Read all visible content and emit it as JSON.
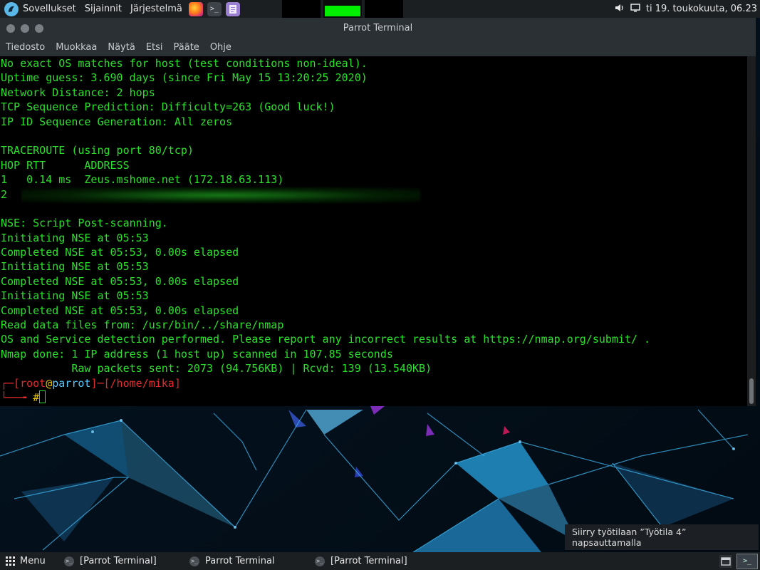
{
  "top_panel": {
    "apps_label": "Sovellukset",
    "places_label": "Sijainnit",
    "system_label": "Järjestelmä",
    "clock": "ti 19. toukokuuta, 06.23",
    "launchers": [
      "firefox-icon",
      "terminal-icon",
      "text-editor-icon"
    ]
  },
  "window": {
    "title": "Parrot Terminal",
    "menu": [
      "Tiedosto",
      "Muokkaa",
      "Näytä",
      "Etsi",
      "Pääte",
      "Ohje"
    ]
  },
  "terminal": {
    "lines": [
      "No exact OS matches for host (test conditions non-ideal).",
      "Uptime guess: 3.690 days (since Fri May 15 13:20:25 2020)",
      "Network Distance: 2 hops",
      "TCP Sequence Prediction: Difficulty=263 (Good luck!)",
      "IP ID Sequence Generation: All zeros",
      "",
      "TRACEROUTE (using port 80/tcp)",
      "HOP RTT      ADDRESS",
      "1   0.14 ms  Zeus.mshome.net (172.18.63.113)",
      "2",
      "",
      "NSE: Script Post-scanning.",
      "Initiating NSE at 05:53",
      "Completed NSE at 05:53, 0.00s elapsed",
      "Initiating NSE at 05:53",
      "Completed NSE at 05:53, 0.00s elapsed",
      "Initiating NSE at 05:53",
      "Completed NSE at 05:53, 0.00s elapsed",
      "Read data files from: /usr/bin/../share/nmap",
      "OS and Service detection performed. Please report any incorrect results at https://nmap.org/submit/ .",
      "Nmap done: 1 IP address (1 host up) scanned in 107.85 seconds",
      "           Raw packets sent: 2073 (94.756KB) | Rcvd: 139 (13.540KB)"
    ],
    "prompt": {
      "user": "root",
      "at": "@",
      "host": "parrot",
      "path": "/home/mika",
      "symbol": "#"
    }
  },
  "notification": "Siirry työtilaan ”Työtila 4” napsauttamalla",
  "bottom_panel": {
    "menu_label": "Menu",
    "tasks": [
      "[Parrot Terminal]",
      "Parrot Terminal",
      "[Parrot Terminal]"
    ]
  },
  "colors": {
    "terminal_green": "#2be02b",
    "prompt_red": "#e22b2b",
    "prompt_yellow": "#e6c400",
    "prompt_cyan": "#55c8ff",
    "panel_bg": "#1b1f22"
  }
}
